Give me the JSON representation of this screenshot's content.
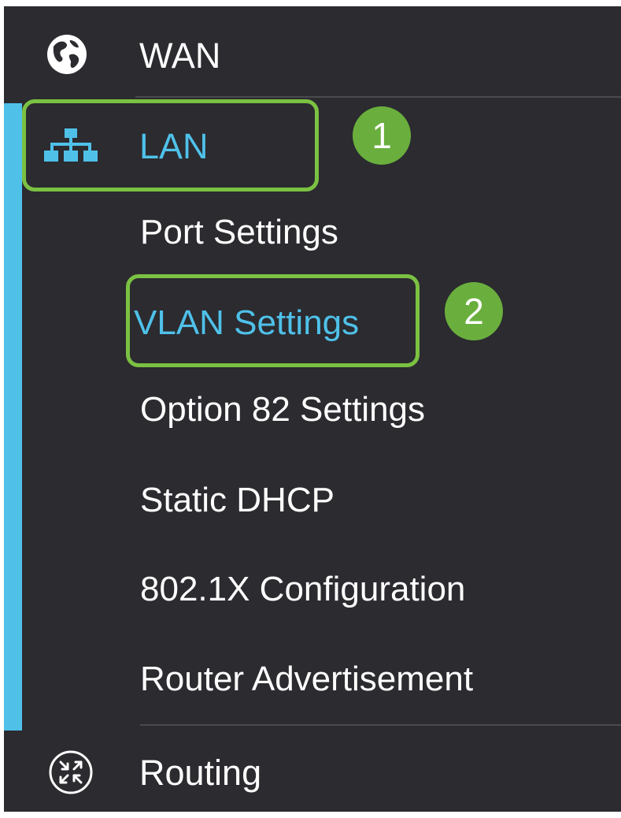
{
  "nav": {
    "wan": {
      "label": "WAN",
      "icon": "globe-icon"
    },
    "lan": {
      "label": "LAN",
      "icon": "network-topology-icon",
      "expanded": true,
      "sub_items": [
        {
          "label": "Port Settings",
          "active": false
        },
        {
          "label": "VLAN Settings",
          "active": true
        },
        {
          "label": "Option 82 Settings",
          "active": false
        },
        {
          "label": "Static DHCP",
          "active": false
        },
        {
          "label": "802.1X Configuration",
          "active": false
        },
        {
          "label": "Router Advertisement",
          "active": false
        }
      ]
    },
    "routing": {
      "label": "Routing",
      "icon": "routing-arrows-icon"
    }
  },
  "callouts": {
    "step1": "1",
    "step2": "2"
  },
  "colors": {
    "panel_background": "#2b2b30",
    "active_accent": "#4fc1e9",
    "highlight_green": "#7bc142",
    "badge_green": "#6aaf3d",
    "text": "#ffffff"
  }
}
